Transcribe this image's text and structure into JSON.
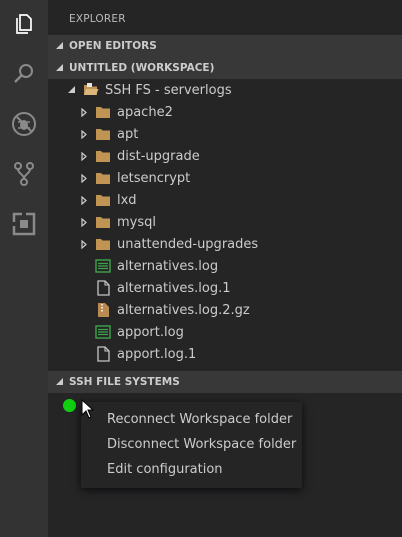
{
  "explorer_title": "EXPLORER",
  "sections": {
    "open_editors": "OPEN EDITORS",
    "workspace": "UNTITLED (WORKSPACE)",
    "ssh_fs": "SSH FILE SYSTEMS"
  },
  "root": {
    "label": "SSH FS - serverlogs"
  },
  "tree_items": [
    {
      "label": "apache2",
      "kind": "folder"
    },
    {
      "label": "apt",
      "kind": "folder"
    },
    {
      "label": "dist-upgrade",
      "kind": "folder"
    },
    {
      "label": "letsencrypt",
      "kind": "folder"
    },
    {
      "label": "lxd",
      "kind": "folder"
    },
    {
      "label": "mysql",
      "kind": "folder"
    },
    {
      "label": "unattended-upgrades",
      "kind": "folder"
    },
    {
      "label": "alternatives.log",
      "kind": "log-file"
    },
    {
      "label": "alternatives.log.1",
      "kind": "file"
    },
    {
      "label": "alternatives.log.2.gz",
      "kind": "archive"
    },
    {
      "label": "apport.log",
      "kind": "log-file"
    },
    {
      "label": "apport.log.1",
      "kind": "file"
    }
  ],
  "context_menu": [
    "Reconnect Workspace folder",
    "Disconnect Workspace folder",
    "Edit configuration"
  ],
  "colors": {
    "activity_bar": "#333333",
    "sidebar": "#252526",
    "section_header": "#383838",
    "folder": "#c09553",
    "connected_dot": "#0fd10f"
  }
}
